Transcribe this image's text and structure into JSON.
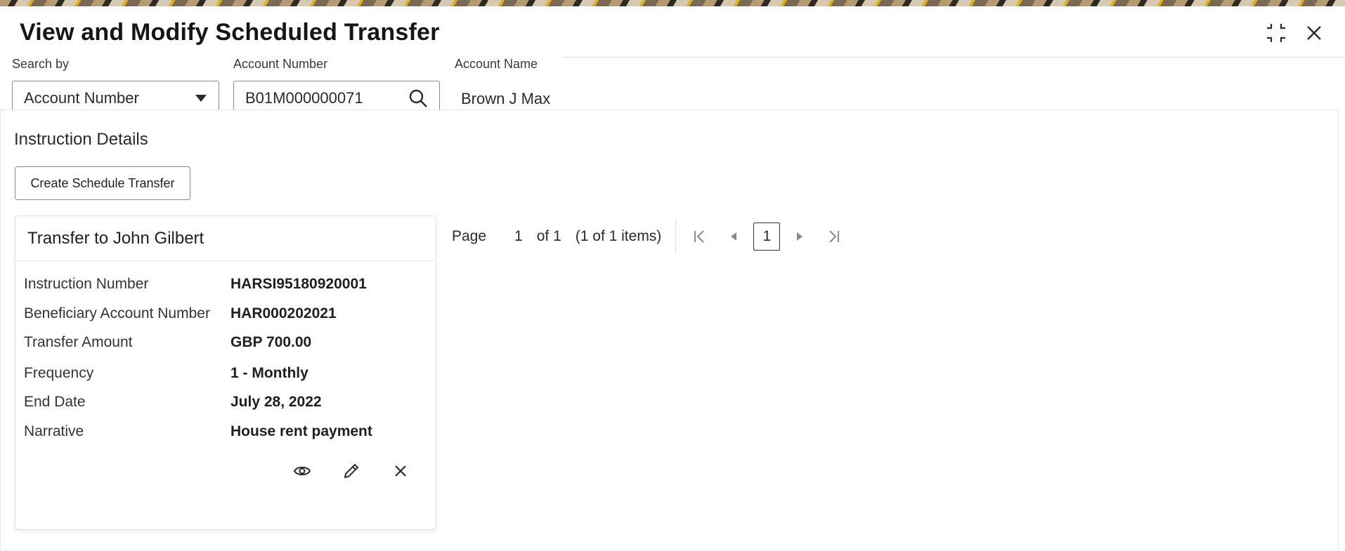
{
  "window": {
    "title": "View and Modify Scheduled Transfer",
    "minimize_icon": "collapse-icon",
    "close_icon": "close-icon"
  },
  "search": {
    "search_by_label": "Search by",
    "search_by_value": "Account Number",
    "account_number_label": "Account Number",
    "account_number_value": "B01M000000071",
    "account_name_label": "Account Name",
    "account_name_value": "Brown J Max"
  },
  "instructions": {
    "section_title": "Instruction Details",
    "create_button_label": "Create Schedule Transfer",
    "card": {
      "title": "Transfer to John Gilbert",
      "rows": [
        {
          "label": "Instruction Number",
          "value": "HARSI95180920001"
        },
        {
          "label": "Beneficiary Account Number",
          "value": "HAR000202021"
        },
        {
          "label": "Transfer Amount",
          "value": "GBP 700.00"
        },
        {
          "label": "Frequency",
          "value": "1 - Monthly"
        },
        {
          "label": "End Date",
          "value": "July 28, 2022"
        },
        {
          "label": "Narrative",
          "value": "House rent payment"
        }
      ]
    }
  },
  "pagination": {
    "page_label": "Page",
    "page_number": "1",
    "of_total": "of 1",
    "items_summary": "(1 of 1 items)",
    "current_page": "1"
  },
  "colors": {
    "text": "#1f1f1f",
    "border": "#8a8a8a",
    "background": "#ffffff"
  }
}
